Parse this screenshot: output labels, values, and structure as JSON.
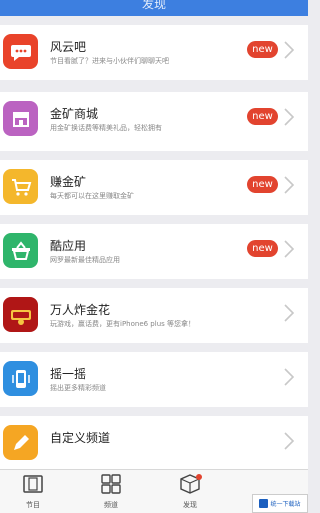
{
  "header": {
    "title": "发现"
  },
  "items": [
    {
      "name": "风云吧",
      "desc": "节目看腻了？进来与小伙伴们聊聊天吧",
      "badge": "new",
      "color": "#e9432a",
      "icon": "chat-bubble-icon"
    },
    {
      "name": "金矿商城",
      "desc": "用金矿换话费等精美礼品，轻松拥有",
      "badge": "new",
      "color": "#bb63c1",
      "icon": "shop-icon"
    },
    {
      "name": "赚金矿",
      "desc": "每天都可以在这里赚取金矿",
      "badge": "new",
      "color": "#f4b72c",
      "icon": "cart-icon"
    },
    {
      "name": "酷应用",
      "desc": "网罗最新最佳精品应用",
      "badge": "new",
      "color": "#2fb56b",
      "icon": "basket-icon"
    },
    {
      "name": "万人炸金花",
      "desc": "玩游戏，赢话费，更有iPhone6 plus 等您拿！",
      "badge": "",
      "color": "#b01616",
      "icon": "game-logo-icon"
    },
    {
      "name": "摇一摇",
      "desc": "摇出更多精彩频道",
      "badge": "",
      "color": "#2f8fe0",
      "icon": "phone-shake-icon"
    },
    {
      "name": "自定义频道",
      "desc": "",
      "badge": "",
      "color": "#f5a623",
      "icon": "edit-icon"
    }
  ],
  "tabs": [
    {
      "label": "节目",
      "icon": "tv-icon"
    },
    {
      "label": "频道",
      "icon": "grid-icon"
    },
    {
      "label": "发现",
      "icon": "cube-icon"
    }
  ],
  "watermark": {
    "text": "统一下载站"
  }
}
